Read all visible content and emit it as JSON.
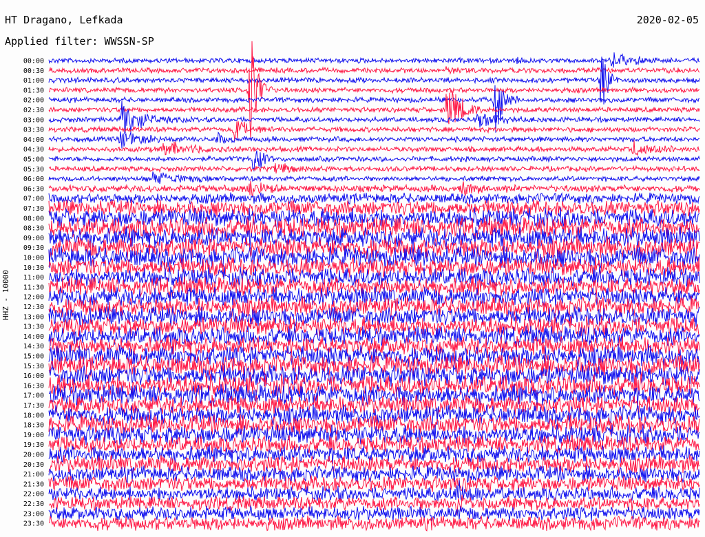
{
  "header": {
    "station": "HT Dragano, Lefkada",
    "filter": "Applied filter: WWSSN-SP",
    "date": "2020-02-05",
    "channel": "HHZ - 10000"
  },
  "chart_data": {
    "type": "line",
    "title": "HT Dragano, Lefkada",
    "subtitle": "Applied filter: WWSSN-SP",
    "date": "2020-02-05",
    "ylabel": "HHZ - 10000",
    "row_labels": [
      "00:00",
      "00:30",
      "01:00",
      "01:30",
      "02:00",
      "02:30",
      "03:00",
      "03:30",
      "04:00",
      "04:30",
      "05:00",
      "05:30",
      "06:00",
      "06:30",
      "07:00",
      "07:30",
      "08:00",
      "08:30",
      "09:00",
      "09:30",
      "10:00",
      "10:30",
      "11:00",
      "11:30",
      "12:00",
      "12:30",
      "13:00",
      "13:30",
      "14:00",
      "14:30",
      "15:00",
      "15:30",
      "16:00",
      "16:30",
      "17:00",
      "17:30",
      "18:00",
      "18:30",
      "19:00",
      "19:30",
      "20:00",
      "20:30",
      "21:00",
      "21:30",
      "22:00",
      "22:30",
      "23:00",
      "23:30"
    ],
    "row_minutes": 30,
    "colors": [
      "#1010ee",
      "#ff1744"
    ],
    "noise_amplitude": [
      3,
      3,
      3,
      3,
      3,
      3,
      3,
      3,
      3,
      3,
      3,
      3,
      3,
      4,
      6,
      9,
      11,
      12,
      12,
      12,
      12,
      11,
      11,
      11,
      11,
      11,
      11,
      11,
      11,
      11,
      12,
      12,
      12,
      12,
      12,
      11,
      11,
      11,
      11,
      10,
      10,
      10,
      9,
      9,
      8,
      8,
      8,
      8
    ],
    "events": [
      {
        "row": 0,
        "time": 26.0,
        "amp": 12,
        "dur": 0.8
      },
      {
        "row": 0,
        "time": 21.6,
        "amp": 4,
        "dur": 0.3
      },
      {
        "row": 1,
        "time": 18.3,
        "amp": 4,
        "dur": 0.4
      },
      {
        "row": 3,
        "time": 9.3,
        "amp": 160,
        "dur": 0.25
      },
      {
        "row": 2,
        "time": 25.5,
        "amp": 95,
        "dur": 0.2
      },
      {
        "row": 4,
        "time": 20.6,
        "amp": 80,
        "dur": 0.3
      },
      {
        "row": 5,
        "time": 18.4,
        "amp": 45,
        "dur": 0.6
      },
      {
        "row": 6,
        "time": 3.4,
        "amp": 35,
        "dur": 0.7
      },
      {
        "row": 6,
        "time": 19.8,
        "amp": 14,
        "dur": 0.8
      },
      {
        "row": 7,
        "time": 8.6,
        "amp": 20,
        "dur": 0.5
      },
      {
        "row": 8,
        "time": 3.3,
        "amp": 14,
        "dur": 1.0
      },
      {
        "row": 9,
        "time": 5.3,
        "amp": 14,
        "dur": 1.0
      },
      {
        "row": 9,
        "time": 27.0,
        "amp": 12,
        "dur": 1.0
      },
      {
        "row": 8,
        "time": 7.8,
        "amp": 8,
        "dur": 0.4
      },
      {
        "row": 10,
        "time": 9.5,
        "amp": 40,
        "dur": 0.25
      },
      {
        "row": 11,
        "time": 10.5,
        "amp": 10,
        "dur": 0.6
      },
      {
        "row": 12,
        "time": 4.8,
        "amp": 12,
        "dur": 1.0
      },
      {
        "row": 13,
        "time": 9.3,
        "amp": 18,
        "dur": 0.5
      },
      {
        "row": 13,
        "time": 19.1,
        "amp": 12,
        "dur": 0.6
      },
      {
        "row": 44,
        "time": 18.8,
        "amp": 14,
        "dur": 0.5
      },
      {
        "row": 45,
        "time": 18.8,
        "amp": 12,
        "dur": 0.5
      }
    ]
  }
}
